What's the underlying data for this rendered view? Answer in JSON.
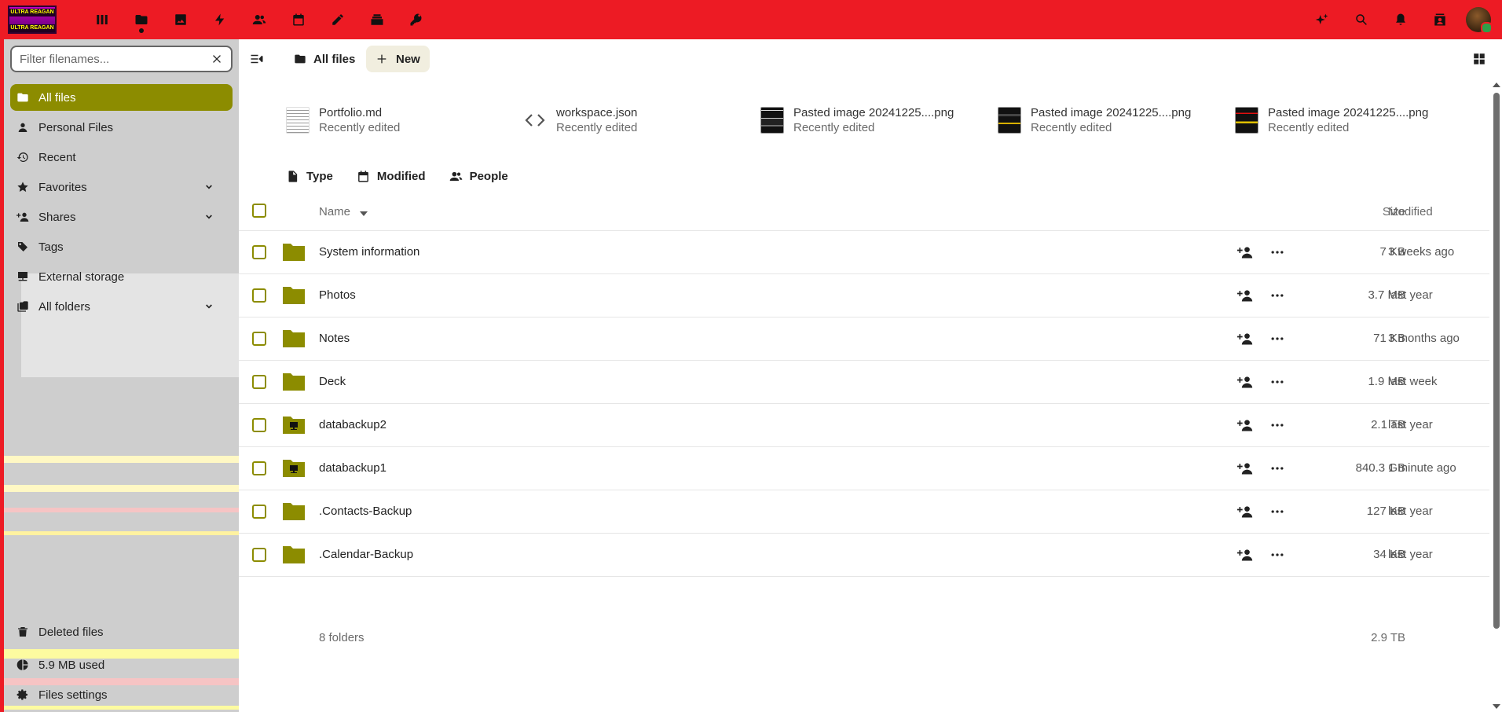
{
  "topbar": {
    "logo_text": "ULTRA REAGAN",
    "apps": [
      "dashboard-icon",
      "files-icon",
      "photos-icon",
      "activity-icon",
      "contacts-icon",
      "calendar-icon",
      "notes-icon",
      "deck-icon",
      "passwords-icon"
    ],
    "right": [
      "assistant-icon",
      "search-icon",
      "notifications-icon",
      "contacts-menu-icon",
      "avatar"
    ]
  },
  "sidebar": {
    "filter_placeholder": "Filter filenames...",
    "items": [
      {
        "label": "All files",
        "icon": "folder-icon",
        "active": true
      },
      {
        "label": "Personal Files",
        "icon": "account-icon"
      },
      {
        "label": "Recent",
        "icon": "history-icon"
      },
      {
        "label": "Favorites",
        "icon": "star-icon",
        "expandable": true
      },
      {
        "label": "Shares",
        "icon": "share-icon",
        "expandable": true
      },
      {
        "label": "Tags",
        "icon": "tag-icon"
      },
      {
        "label": "External storage",
        "icon": "server-icon"
      },
      {
        "label": "All folders",
        "icon": "folder-multiple-icon",
        "expandable": true
      }
    ],
    "deleted_files": "Deleted files",
    "quota": "5.9 MB used",
    "settings": "Files settings",
    "colors": {
      "active": "#8c8c00",
      "background": "#cecece"
    }
  },
  "header": {
    "breadcrumb": "All files",
    "new_button": "New"
  },
  "recent_files": [
    {
      "name": "Portfolio.md",
      "status": "Recently edited"
    },
    {
      "name": "workspace.json",
      "status": "Recently edited"
    },
    {
      "name": "Pasted image 20241225....png",
      "status": "Recently edited"
    },
    {
      "name": "Pasted image 20241225....png",
      "status": "Recently edited"
    },
    {
      "name": "Pasted image 20241225....png",
      "status": "Recently edited"
    }
  ],
  "filters": [
    "Type",
    "Modified",
    "People"
  ],
  "table": {
    "headers": {
      "name": "Name",
      "size": "Size",
      "modified": "Modified"
    },
    "rows": [
      {
        "name": "System information",
        "size": "7 KB",
        "modified": "3 weeks ago",
        "external": false
      },
      {
        "name": "Photos",
        "size": "3.7 MB",
        "modified": "last year",
        "external": false
      },
      {
        "name": "Notes",
        "size": "71 KB",
        "modified": "3 months ago",
        "external": false
      },
      {
        "name": "Deck",
        "size": "1.9 MB",
        "modified": "last week",
        "external": false
      },
      {
        "name": "databackup2",
        "size": "2.1 TB",
        "modified": "last year",
        "external": true
      },
      {
        "name": "databackup1",
        "size": "840.3 GB",
        "modified": "1 minute ago",
        "external": true
      },
      {
        "name": ".Contacts-Backup",
        "size": "127 KB",
        "modified": "last year",
        "external": false
      },
      {
        "name": ".Calendar-Backup",
        "size": "34 KB",
        "modified": "last year",
        "external": false
      }
    ],
    "summary": {
      "count": "8 folders",
      "total": "2.9 TB"
    }
  },
  "colors": {
    "topbar": "#ed1b24",
    "folder": "#8c8c00",
    "accent_bg": "#f1eedf"
  }
}
